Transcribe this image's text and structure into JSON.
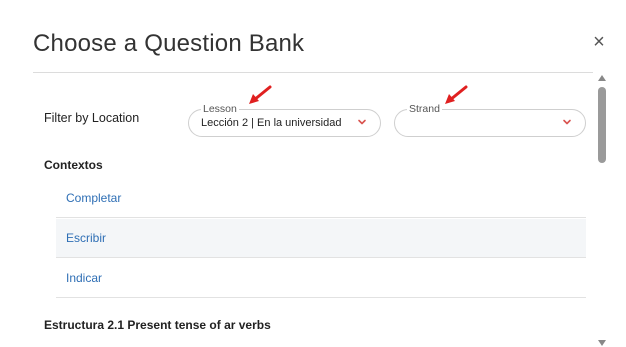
{
  "dialog": {
    "title": "Choose a Question Bank",
    "close_label": "×"
  },
  "filter": {
    "label": "Filter by Location",
    "lesson": {
      "legend": "Lesson",
      "value": "Lección 2 | En la universidad"
    },
    "strand": {
      "legend": "Strand",
      "value": ""
    }
  },
  "sections": [
    {
      "heading": "Contextos",
      "items": [
        {
          "label": "Completar"
        },
        {
          "label": "Escribir"
        },
        {
          "label": "Indicar"
        }
      ]
    },
    {
      "heading": "Estructura 2.1 Present tense of ar verbs",
      "items": []
    }
  ],
  "colors": {
    "link": "#2f6fb5",
    "annotation_arrow": "#e02020",
    "chevron": "#d9534f"
  },
  "icons": {
    "close": "close-icon",
    "dropdown": "chevron-down-icon",
    "annotation": "red-arrow-icon"
  }
}
